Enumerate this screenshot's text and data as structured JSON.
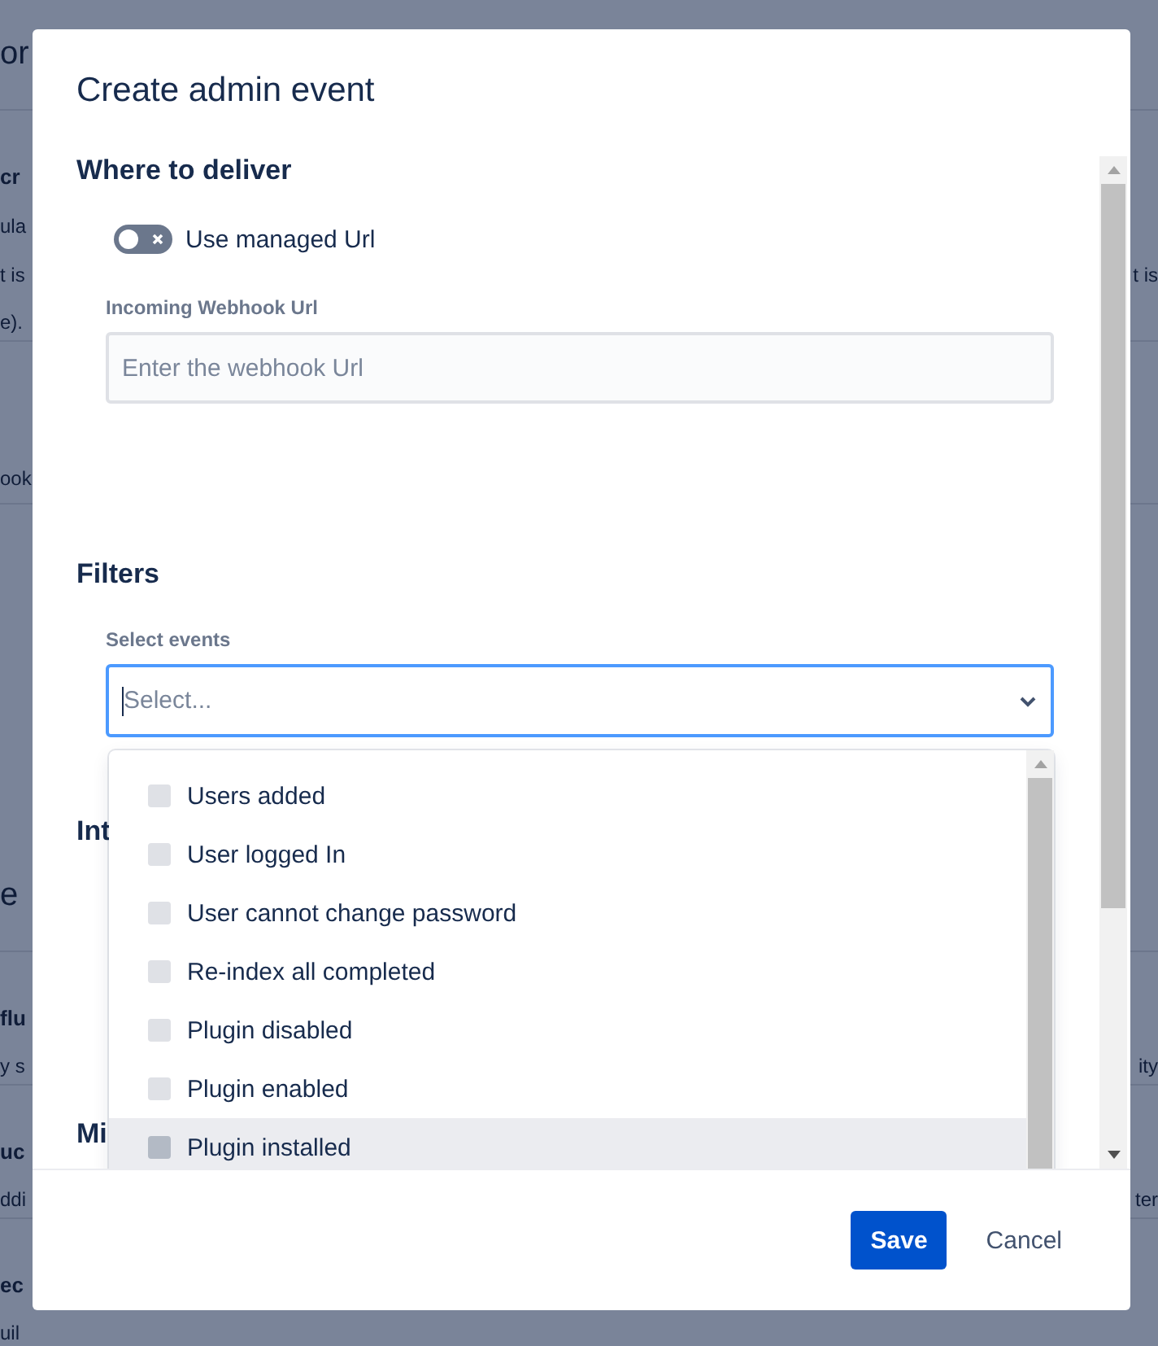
{
  "background_page": {
    "rows": [
      {
        "kind": "title",
        "left": "or",
        "right": ""
      },
      {
        "kind": "bold",
        "left": "cr",
        "right": ""
      },
      {
        "kind": "text",
        "left": "ula",
        "right": ""
      },
      {
        "kind": "text",
        "left": "t is",
        "right": "t is"
      },
      {
        "kind": "last",
        "left": "e).",
        "right": ""
      },
      {
        "kind": "tall",
        "left": "ook",
        "right": ""
      },
      {
        "kind": "heading",
        "left": "e",
        "right": ""
      },
      {
        "kind": "bold",
        "left": "flu",
        "right": ""
      },
      {
        "kind": "last",
        "left": "y s",
        "right": "ity"
      },
      {
        "kind": "bold",
        "left": "uc",
        "right": ""
      },
      {
        "kind": "last",
        "left": "ddi",
        "right": "ter"
      },
      {
        "kind": "bold",
        "left": "ec",
        "right": ""
      },
      {
        "kind": "last",
        "left": "uil",
        "right": ""
      }
    ]
  },
  "modal": {
    "title": "Create admin event",
    "sections": [
      {
        "heading": "Where to deliver",
        "kind": "delivery"
      },
      {
        "heading": "Filters",
        "kind": "filters"
      },
      {
        "heading": "Int",
        "kind": "plain"
      },
      {
        "heading": "Mi",
        "kind": "plain"
      }
    ],
    "toggle": {
      "label": "Use managed Url",
      "on": false
    },
    "webhook_field": {
      "label": "Incoming Webhook Url",
      "placeholder": "Enter the webhook Url"
    },
    "events_select": {
      "label": "Select events",
      "placeholder": "Select...",
      "focused": true,
      "expanded": true,
      "options": [
        {
          "label": "Users added",
          "checked": false,
          "selected": false
        },
        {
          "label": "User logged In",
          "checked": false,
          "selected": false
        },
        {
          "label": "User cannot change password",
          "checked": false,
          "selected": false
        },
        {
          "label": "Re-index all completed",
          "checked": false,
          "selected": false
        },
        {
          "label": "Plugin disabled",
          "checked": false,
          "selected": false
        },
        {
          "label": "Plugin enabled",
          "checked": false,
          "selected": false
        },
        {
          "label": "Plugin installed",
          "checked": false,
          "selected": true
        }
      ]
    },
    "buttons": [
      {
        "label": "Save",
        "kind": "primary"
      },
      {
        "label": "Cancel",
        "kind": "subtle"
      }
    ]
  }
}
